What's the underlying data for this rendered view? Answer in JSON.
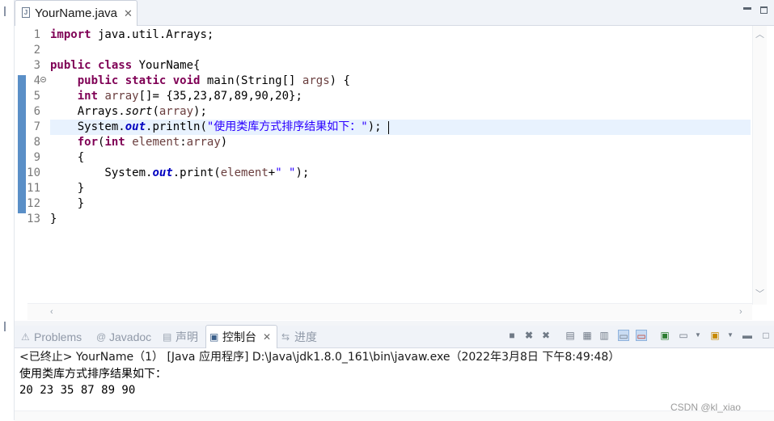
{
  "editor": {
    "tab_title": "YourName.java",
    "file_icon_letter": "J",
    "line_numbers": [
      "1",
      "2",
      "3",
      "4",
      "5",
      "6",
      "7",
      "8",
      "9",
      "10",
      "11",
      "12",
      "13"
    ],
    "lines": [
      [
        {
          "t": "import",
          "c": "kw"
        },
        {
          "t": " java.util.Arrays;",
          "c": ""
        }
      ],
      [],
      [
        {
          "t": "public",
          "c": "kw"
        },
        {
          "t": " ",
          "c": ""
        },
        {
          "t": "class",
          "c": "kw"
        },
        {
          "t": " YourName{",
          "c": ""
        }
      ],
      [
        {
          "t": "    ",
          "c": ""
        },
        {
          "t": "public",
          "c": "kw"
        },
        {
          "t": " ",
          "c": ""
        },
        {
          "t": "static",
          "c": "kw"
        },
        {
          "t": " ",
          "c": ""
        },
        {
          "t": "void",
          "c": "kw"
        },
        {
          "t": " main(String[] ",
          "c": ""
        },
        {
          "t": "args",
          "c": "var"
        },
        {
          "t": ") {",
          "c": ""
        }
      ],
      [
        {
          "t": "    ",
          "c": ""
        },
        {
          "t": "int",
          "c": "kw"
        },
        {
          "t": " ",
          "c": ""
        },
        {
          "t": "array",
          "c": "var"
        },
        {
          "t": "[]= {35,23,87,89,90,20};",
          "c": ""
        }
      ],
      [
        {
          "t": "    Arrays.",
          "c": ""
        },
        {
          "t": "sort",
          "c": "ital"
        },
        {
          "t": "(",
          "c": ""
        },
        {
          "t": "array",
          "c": "var"
        },
        {
          "t": ");",
          "c": ""
        }
      ],
      [
        {
          "t": "    System.",
          "c": ""
        },
        {
          "t": "out",
          "c": "fld"
        },
        {
          "t": ".println(",
          "c": ""
        },
        {
          "t": "\"使用类库方式排序结果如下：\"",
          "c": "str"
        },
        {
          "t": ");",
          "c": ""
        }
      ],
      [
        {
          "t": "    ",
          "c": ""
        },
        {
          "t": "for",
          "c": "kw"
        },
        {
          "t": "(",
          "c": ""
        },
        {
          "t": "int",
          "c": "kw"
        },
        {
          "t": " ",
          "c": ""
        },
        {
          "t": "element",
          "c": "var"
        },
        {
          "t": ":",
          "c": ""
        },
        {
          "t": "array",
          "c": "var"
        },
        {
          "t": ")",
          "c": ""
        }
      ],
      [
        {
          "t": "    {",
          "c": ""
        }
      ],
      [
        {
          "t": "        System.",
          "c": ""
        },
        {
          "t": "out",
          "c": "fld"
        },
        {
          "t": ".print(",
          "c": ""
        },
        {
          "t": "element",
          "c": "var"
        },
        {
          "t": "+",
          "c": ""
        },
        {
          "t": "\" \"",
          "c": "str"
        },
        {
          "t": ");",
          "c": ""
        }
      ],
      [
        {
          "t": "    }",
          "c": ""
        }
      ],
      [
        {
          "t": "    }",
          "c": ""
        }
      ],
      [
        {
          "t": "}",
          "c": ""
        }
      ]
    ],
    "current_line": 7
  },
  "panel": {
    "tabs": [
      {
        "label": "Problems",
        "icon": "problems-icon",
        "glyph": "⚠"
      },
      {
        "label": "Javadoc",
        "icon": "javadoc-icon",
        "glyph": "@"
      },
      {
        "label": "声明",
        "icon": "declaration-icon",
        "glyph": "▤"
      },
      {
        "label": "控制台",
        "icon": "console-icon",
        "glyph": "▣",
        "active": true
      },
      {
        "label": "进度",
        "icon": "progress-icon",
        "glyph": "⇆"
      }
    ]
  },
  "console": {
    "status": "<已终止> YourName（1） [Java 应用程序] D:\\Java\\jdk1.8.0_161\\bin\\javaw.exe（2022年3月8日 下午8:49:48）",
    "output": [
      "使用类库方式排序结果如下：",
      "20 23 35 87 89 90"
    ]
  },
  "watermark": "CSDN @kl_xiao",
  "colors": {
    "keyword": "#7f0055",
    "string": "#2a00ff",
    "field": "#0000c0",
    "variable": "#6a3e3e",
    "current_line": "#e8f2fe",
    "gutter_mark": "#5a8fc7"
  }
}
